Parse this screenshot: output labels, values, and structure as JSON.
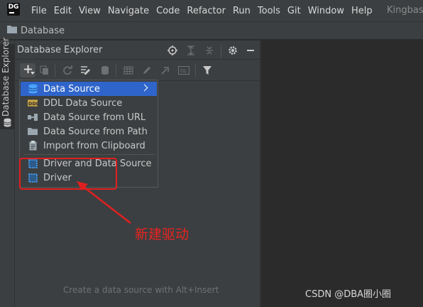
{
  "app": {
    "logo_text": "DG",
    "menu": [
      "File",
      "Edit",
      "View",
      "Navigate",
      "Code",
      "Refactor",
      "Run",
      "Tools",
      "Git",
      "Window",
      "Help"
    ],
    "project_name": "Kingbase"
  },
  "breadcrumb": {
    "label": "Database"
  },
  "tool_stripe": {
    "label": "Database Explorer"
  },
  "panel": {
    "title": "Database Explorer",
    "empty_hint": "Create a data source with Alt+Insert"
  },
  "dropdown": {
    "items": [
      {
        "label": "Data Source",
        "icon": "data-source-icon",
        "selected": true,
        "has_submenu": true
      },
      {
        "label": "DDL Data Source",
        "icon": "ddl-icon"
      },
      {
        "label": "Data Source from URL",
        "icon": "url-icon"
      },
      {
        "label": "Data Source from Path",
        "icon": "folder-icon"
      },
      {
        "label": "Import from Clipboard",
        "icon": "clipboard-icon"
      },
      {
        "label": "Driver and Data Source",
        "icon": "driver-datasource-icon"
      },
      {
        "label": "Driver",
        "icon": "driver-icon"
      }
    ]
  },
  "annotation": {
    "text": "新建驱动",
    "color": "#e8231f"
  },
  "watermark": "CSDN @DBA圈小圈",
  "colors": {
    "selection": "#2f65ca",
    "panel_bg": "#3c3f41",
    "editor_bg": "#2b2b2b",
    "annotation_red": "#e02020"
  }
}
